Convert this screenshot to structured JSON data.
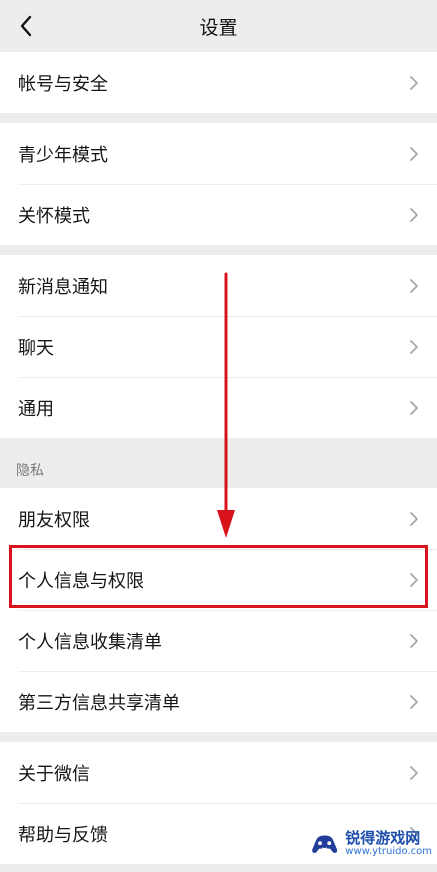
{
  "header": {
    "title": "设置"
  },
  "groups": [
    {
      "items": [
        {
          "label": "帐号与安全"
        }
      ]
    },
    {
      "items": [
        {
          "label": "青少年模式"
        },
        {
          "label": "关怀模式"
        }
      ]
    },
    {
      "items": [
        {
          "label": "新消息通知"
        },
        {
          "label": "聊天"
        },
        {
          "label": "通用"
        }
      ]
    },
    {
      "section_label": "隐私",
      "items": [
        {
          "label": "朋友权限"
        },
        {
          "label": "个人信息与权限"
        },
        {
          "label": "个人信息收集清单"
        },
        {
          "label": "第三方信息共享清单"
        }
      ]
    },
    {
      "items": [
        {
          "label": "关于微信"
        },
        {
          "label": "帮助与反馈"
        }
      ]
    }
  ],
  "watermark": {
    "title": "锐得游戏网",
    "url": "www.ytruido.com"
  },
  "colors": {
    "background": "#ededed",
    "surface": "#ffffff",
    "highlight": "#d9131b",
    "watermark_blue": "#1f4fae"
  }
}
